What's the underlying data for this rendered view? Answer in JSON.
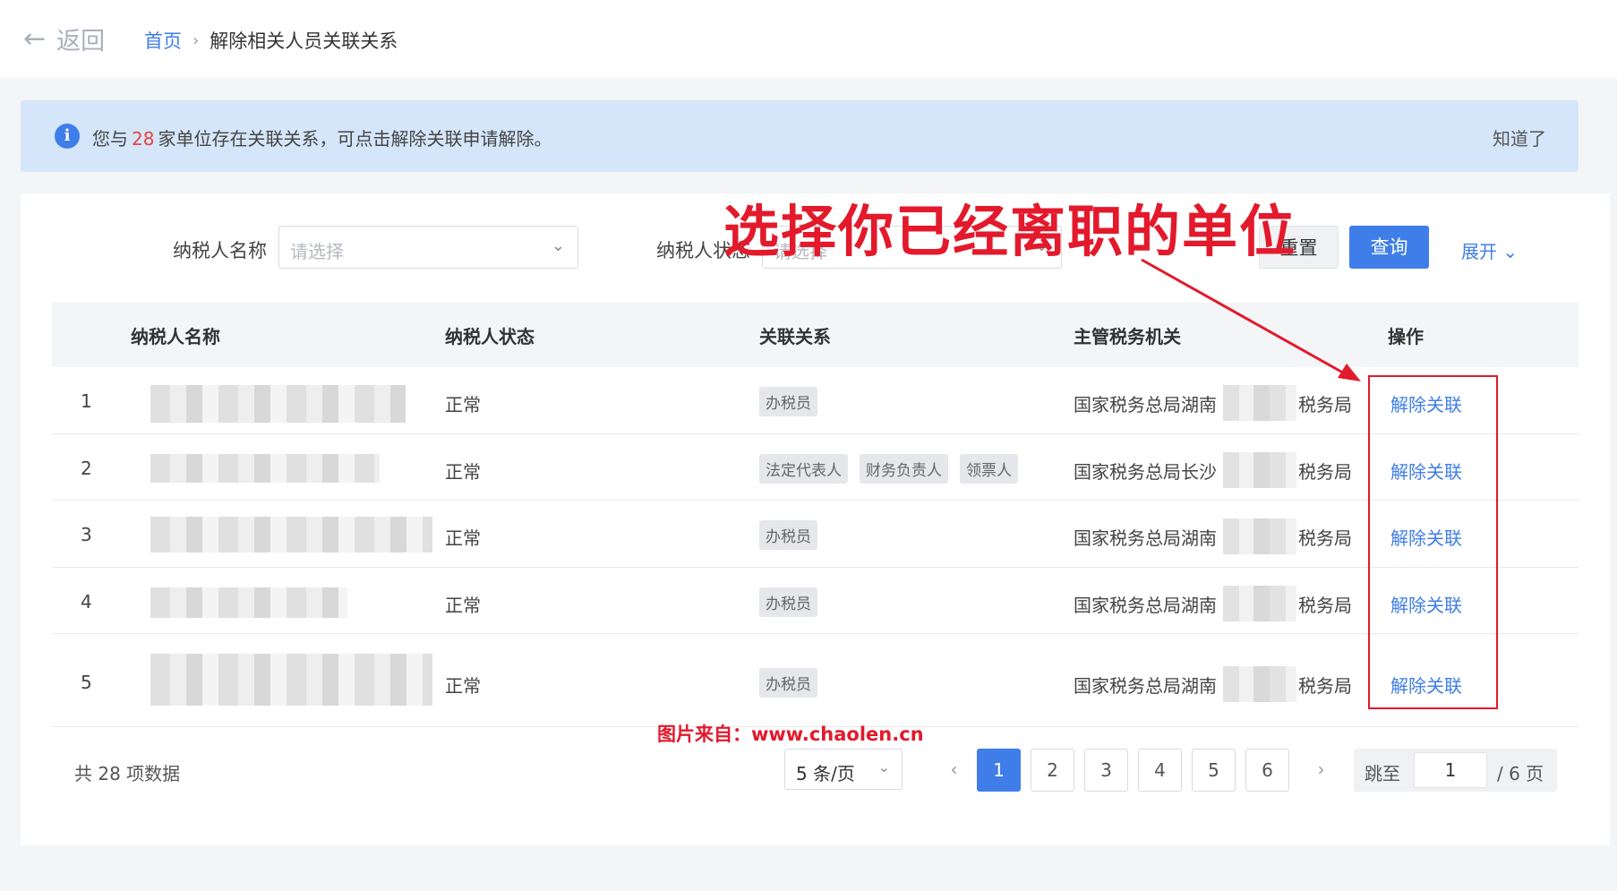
{
  "nav": {
    "back_label": "返回",
    "breadcrumb_home": "首页",
    "breadcrumb_current": "解除相关人员关联关系"
  },
  "notice": {
    "prefix": "您与",
    "count": "28",
    "suffix": "家单位存在关联关系，可点击解除关联申请解除。",
    "dismiss": "知道了"
  },
  "filters": {
    "taxpayer_name_label": "纳税人名称",
    "taxpayer_name_placeholder": "请选择",
    "taxpayer_status_label": "纳税人状态",
    "taxpayer_status_placeholder": "请选择",
    "reset": "重置",
    "query": "查询",
    "expand": "展开"
  },
  "table": {
    "headers": [
      "纳税人名称",
      "纳税人状态",
      "关联关系",
      "主管税务机关",
      "操作"
    ],
    "rows": [
      {
        "index": "1",
        "status": "正常",
        "relations": [
          "办税员"
        ],
        "authority_prefix": "国家税务总局湖南",
        "authority_suffix": "税务局",
        "action": "解除关联"
      },
      {
        "index": "2",
        "status": "正常",
        "relations": [
          "法定代表人",
          "财务负责人",
          "领票人"
        ],
        "authority_prefix": "国家税务总局长沙",
        "authority_suffix": "税务局",
        "action": "解除关联"
      },
      {
        "index": "3",
        "status": "正常",
        "relations": [
          "办税员"
        ],
        "authority_prefix": "国家税务总局湖南",
        "authority_suffix": "税务局",
        "action": "解除关联"
      },
      {
        "index": "4",
        "status": "正常",
        "relations": [
          "办税员"
        ],
        "authority_prefix": "国家税务总局湖南",
        "authority_suffix": "税务局",
        "action": "解除关联"
      },
      {
        "index": "5",
        "status": "正常",
        "relations": [
          "办税员"
        ],
        "authority_prefix": "国家税务总局湖南",
        "authority_suffix": "税务局",
        "action": "解除关联"
      }
    ]
  },
  "pagination": {
    "total_text": "共 28 项数据",
    "page_size": "5 条/页",
    "pages": [
      "1",
      "2",
      "3",
      "4",
      "5",
      "6"
    ],
    "current_page": "1",
    "jump_label": "跳至",
    "jump_value": "1",
    "total_pages_text": "/ 6 页"
  },
  "annotations": {
    "instruction": "选择你已经离职的单位",
    "credit": "图片来自：www.chaolen.cn"
  },
  "colors": {
    "primary": "#3f7ee8",
    "notice_bg": "#d5e6fb",
    "annotation_red": "#e3192c"
  }
}
